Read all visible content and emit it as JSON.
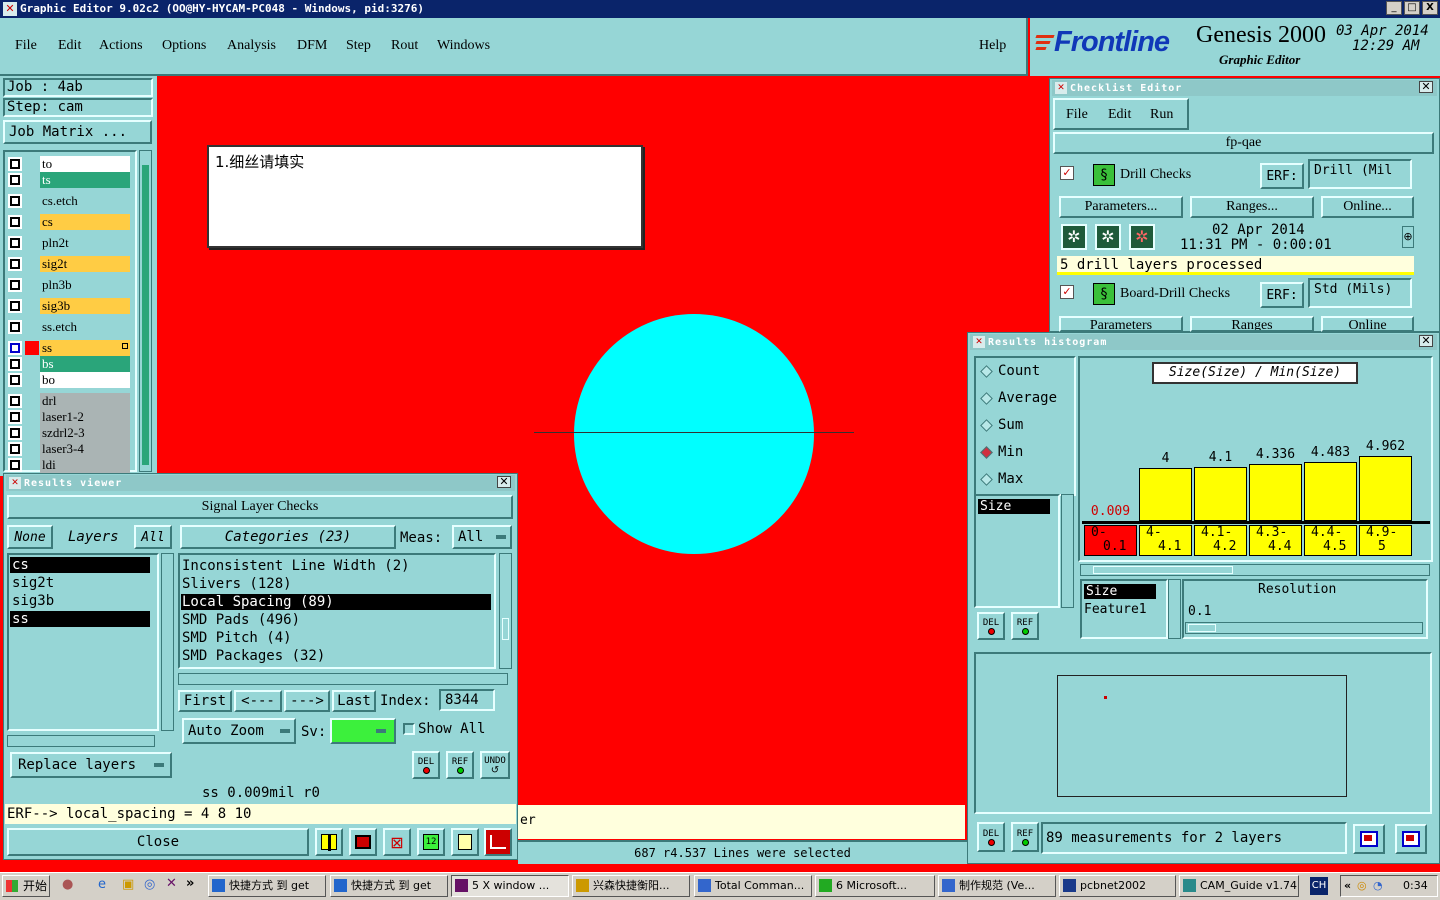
{
  "window": {
    "title": "Graphic Editor 9.02c2  (OO@HY-HYCAM-PC048 - Windows, pid:3276)",
    "controls": [
      "_",
      "□",
      "X"
    ]
  },
  "menu": [
    "File",
    "Edit",
    "Actions",
    "Options",
    "Analysis",
    "DFM",
    "Step",
    "Rout",
    "Windows"
  ],
  "help": "Help",
  "brand": {
    "logo": "Frontline",
    "product": "Genesis 2000",
    "subtitle": "Graphic Editor",
    "date": "03 Apr 2014",
    "time": "12:29 AM"
  },
  "job": {
    "job_label": "Job  :  4ab",
    "step_label": "Step:  cam",
    "matrix_btn": "Job Matrix ..."
  },
  "layers": [
    {
      "name": "to",
      "color": "#ffffff",
      "sel": false
    },
    {
      "name": "ts",
      "color": "#2aa57a",
      "sel": false
    },
    {
      "name": "cs.etch",
      "color": "#96d6d6",
      "sel": false
    },
    {
      "name": "cs",
      "color": "#ffcc44",
      "sel": false
    },
    {
      "name": "pln2t",
      "color": "#96d6d6",
      "sel": false
    },
    {
      "name": "sig2t",
      "color": "#ffcc44",
      "sel": false
    },
    {
      "name": "pln3b",
      "color": "#96d6d6",
      "sel": false
    },
    {
      "name": "sig3b",
      "color": "#ffcc44",
      "sel": false
    },
    {
      "name": "ss.etch",
      "color": "#96d6d6",
      "sel": false
    },
    {
      "name": "ss",
      "color": "#ffcc44",
      "sel": true
    },
    {
      "name": "bs",
      "color": "#2aa57a",
      "sel": false
    },
    {
      "name": "bo",
      "color": "#ffffff",
      "sel": false
    },
    {
      "name": "drl",
      "color": "#aab4b4",
      "sel": false
    },
    {
      "name": "laser1-2",
      "color": "#aab4b4",
      "sel": false
    },
    {
      "name": "szdrl2-3",
      "color": "#aab4b4",
      "sel": false
    },
    {
      "name": "laser3-4",
      "color": "#aab4b4",
      "sel": false
    },
    {
      "name": "ldi",
      "color": "#aab4b4",
      "sel": false
    }
  ],
  "note": "1.细丝请填实",
  "colors": {
    "canvas": "#ff0000",
    "pad": "#00ffff",
    "panel": "#96d6d6",
    "bar": "#ffff00"
  },
  "checklist": {
    "title": "Checklist Editor",
    "menu": [
      "File",
      "Edit",
      "Run"
    ],
    "name": "fp-qae",
    "items": [
      {
        "label": "Drill Checks",
        "erf": "ERF:",
        "erf_value": "Drill (Mil"
      },
      {
        "label": "Board-Drill Checks",
        "erf": "ERF:",
        "erf_value": "Std (Mils)"
      }
    ],
    "buttons": [
      "Parameters...",
      "Ranges...",
      "Online..."
    ],
    "buttons2": [
      "Parameters",
      "Ranges",
      "Online"
    ],
    "run_date": "02 Apr 2014",
    "run_time": "11:31 PM - 0:00:01",
    "status": "5 drill layers processed"
  },
  "histogram": {
    "title": "Results histogram",
    "modes": [
      "Count",
      "Average",
      "Sum",
      "Min",
      "Max"
    ],
    "selected_mode": "Min",
    "list_items": [
      "Size"
    ],
    "chart_title": "Size(Size) / Min(Size)",
    "fields": [
      "Size",
      "Feature1"
    ],
    "resolution_label": "Resolution",
    "resolution_value": "0.1",
    "summary": "89 measurements for 2 layers",
    "del": "DEL",
    "ref": "REF"
  },
  "chart_data": {
    "type": "bar",
    "title": "Size(Size) / Min(Size)",
    "categories": [
      "0-0.1",
      "4-4.1",
      "4.1-4.2",
      "4.3-4.4",
      "4.4-4.5",
      "4.9-5"
    ],
    "category_lines": [
      [
        "0-",
        "0.1"
      ],
      [
        "4-",
        "4.1"
      ],
      [
        "4.1-",
        "4.2"
      ],
      [
        "4.3-",
        "4.4"
      ],
      [
        "4.4-",
        "4.5"
      ],
      [
        "4.9-",
        "5"
      ]
    ],
    "values": [
      0.009,
      4,
      4.1,
      4.336,
      4.483,
      4.962
    ],
    "value_labels": [
      "0.009",
      "4",
      "4.1",
      "4.336",
      "4.483",
      "4.962"
    ],
    "highlight_index": 0,
    "ylim": [
      0,
      5
    ]
  },
  "results_viewer": {
    "title": "Results viewer",
    "header": "Signal Layer Checks",
    "none_btn": "None",
    "layers_label": "Layers",
    "all_btn": "All",
    "layers": [
      "cs",
      "sig2t",
      "sig3b",
      "ss"
    ],
    "selected_layers": [
      "cs",
      "ss"
    ],
    "categories_label": "Categories (23)",
    "meas_label": "Meas:",
    "meas_value": "All",
    "categories": [
      "Inconsistent Line Width (2)",
      "Slivers (128)",
      "Local Spacing (89)",
      "SMD Pads (496)",
      "SMD Pitch (4)",
      "SMD Packages (32)"
    ],
    "selected_category": "Local Spacing (89)",
    "nav": [
      "First",
      "<---",
      "--->",
      "Last"
    ],
    "index_label": "Index:",
    "index_value": "8344",
    "auto_zoom": "Auto Zoom",
    "sv_label": "Sv:",
    "show_all": "Show All",
    "replace_layers": "Replace layers",
    "info": "ss 0.009mil  r0",
    "erf": "ERF--> local_spacing = 4 8 10",
    "close": "Close",
    "undo": "UNDO"
  },
  "status_strip": {
    "partial": "er",
    "message": "687 r4.537 Lines were selected"
  },
  "taskbar": {
    "start": "开始",
    "items": [
      "快捷方式 到 get",
      "快捷方式 到 get",
      "5 X window ...",
      "兴森快捷衡阳...",
      "Total Comman...",
      "6 Microsoft...",
      "制作规范 (Ve...",
      "pcbnet2002",
      "CAM_Guide v1.74"
    ],
    "lang": "CH",
    "clock": "0:34"
  }
}
